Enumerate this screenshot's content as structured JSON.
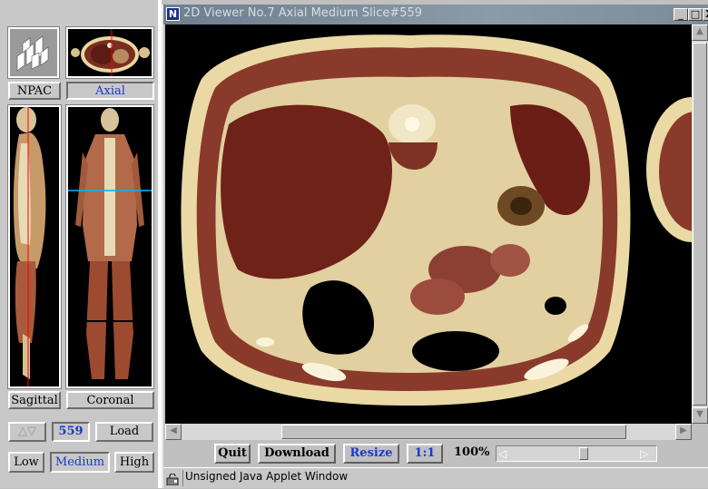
{
  "panel": {
    "logo_label": "NPAC",
    "axial_label": "Axial",
    "sagittal_label": "Sagittal",
    "coronal_label": "Coronal",
    "slice_value": "559",
    "load_label": "Load",
    "quality_low": "Low",
    "quality_medium": "Medium",
    "quality_high": "High"
  },
  "window": {
    "title": "2D Viewer No.7 Axial Medium Slice#559",
    "icon_letter": "N",
    "minimize": "_",
    "maximize": "□",
    "close": "X"
  },
  "toolbar": {
    "quit": "Quit",
    "download": "Download",
    "resize": "Resize",
    "ratio": "1:1",
    "zoom": "100%"
  },
  "zoom_slider_fraction": 0.55,
  "status": {
    "text": "Unsigned Java Applet Window"
  },
  "colors": {
    "accent": "#1a3ac8",
    "active_text": "#1a3ac8",
    "cut_line": "#ff0000",
    "axial_line": "#00b4ff"
  }
}
